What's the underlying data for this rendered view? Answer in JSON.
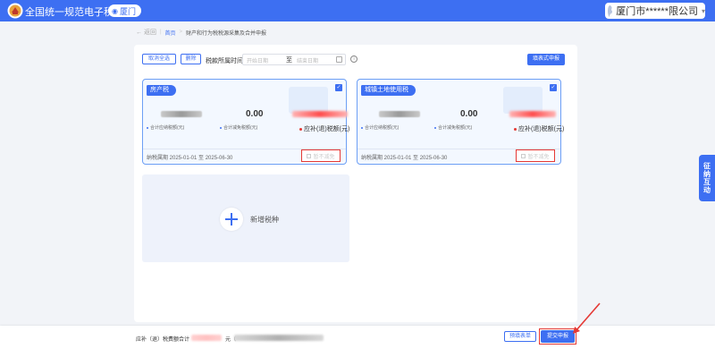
{
  "header": {
    "app_title": "全国统一规范电子税务局",
    "region": "厦门",
    "user_name": "厦门市******限公司",
    "colors": {
      "brand": "#3d6ff2",
      "alert": "#e53935"
    }
  },
  "breadcrumb": {
    "back": "← 返回",
    "home": "首页",
    "separator": ">",
    "current": "财产和行为税税源采集及合并申报"
  },
  "toolbar": {
    "cancel_select_all": "取消全选",
    "delete": "删除",
    "period_label": "税款所属时间",
    "start_placeholder": "开始日期",
    "range_to": "至",
    "end_placeholder": "结束日期",
    "form_declare": "填表式申报"
  },
  "cards": [
    {
      "title": "房产税",
      "checked": true,
      "total_tax_label": "合计应纳税额(元)",
      "reduction_amount": "0.00",
      "reduction_label": "合计减免税额(元)",
      "payable_label": "应补(退)税额(元)",
      "period": "纳税属期 2025-01-01 至 2025-06-30",
      "waive_label": "暂不减免"
    },
    {
      "title": "城镇土地使用税",
      "checked": true,
      "total_tax_label": "合计应纳税额(元)",
      "reduction_amount": "0.00",
      "reduction_label": "合计减免税额(元)",
      "payable_label": "应补(退)税额(元)",
      "period": "纳税属期 2025-01-01 至 2025-06-30",
      "waive_label": "暂不减免"
    }
  ],
  "add_card": {
    "label": "新增税种"
  },
  "side_tab": {
    "label": "征纳互动"
  },
  "footer": {
    "total_label": "应补（退）税费额合计",
    "unit": "元（",
    "preview": "预填表单",
    "submit": "提交申报"
  }
}
